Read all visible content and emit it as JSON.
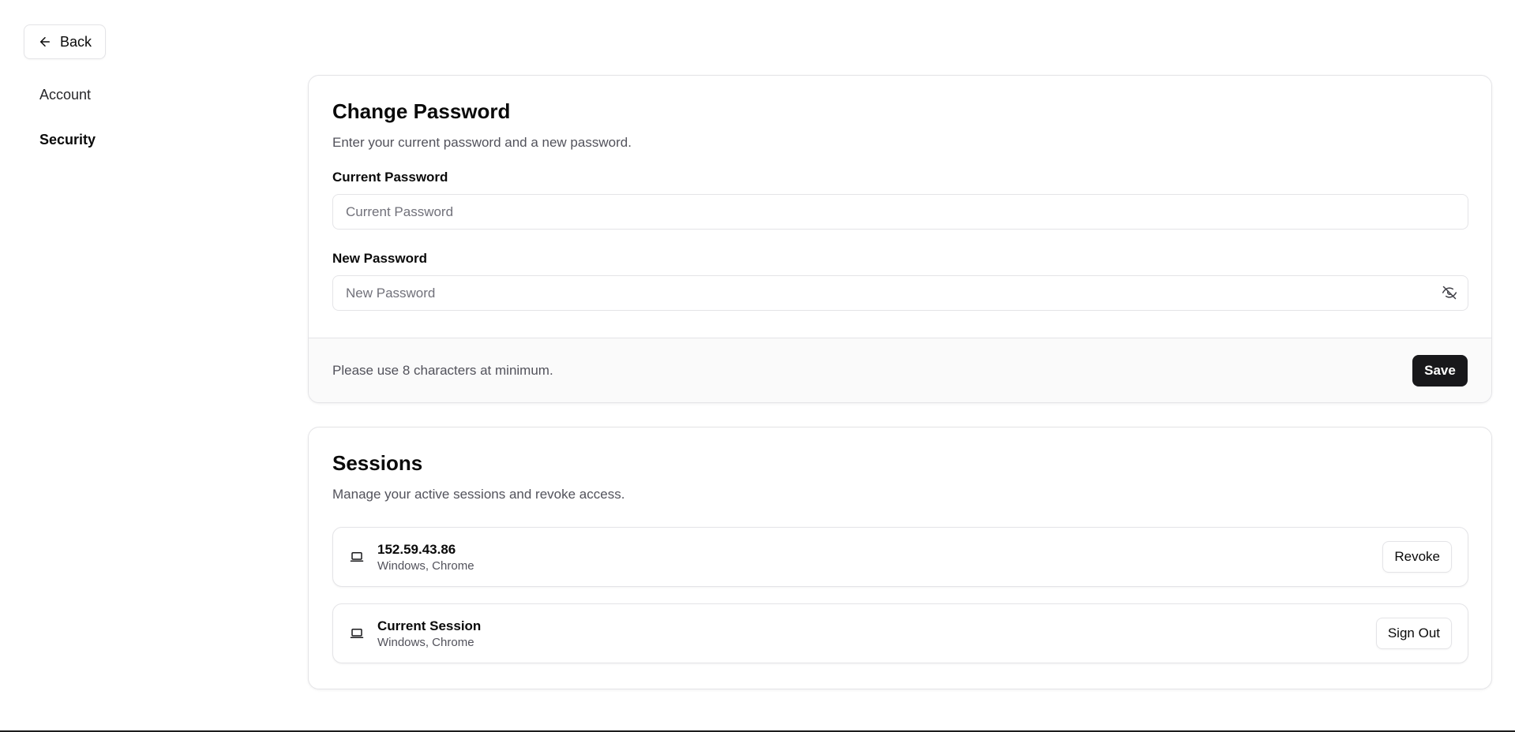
{
  "nav": {
    "back_label": "Back",
    "items": [
      {
        "label": "Account",
        "active": false
      },
      {
        "label": "Security",
        "active": true
      }
    ]
  },
  "change_password": {
    "title": "Change Password",
    "description": "Enter your current password and a new password.",
    "current_password": {
      "label": "Current Password",
      "placeholder": "Current Password",
      "value": ""
    },
    "new_password": {
      "label": "New Password",
      "placeholder": "New Password",
      "value": "",
      "visibility_icon": "eye-off-icon"
    },
    "footer_note": "Please use 8 characters at minimum.",
    "save_label": "Save"
  },
  "sessions": {
    "title": "Sessions",
    "description": "Manage your active sessions and revoke access.",
    "items": [
      {
        "name": "152.59.43.86",
        "meta": "Windows, Chrome",
        "action": "Revoke",
        "icon": "laptop-icon"
      },
      {
        "name": "Current Session",
        "meta": "Windows, Chrome",
        "action": "Sign Out",
        "icon": "laptop-icon"
      }
    ]
  },
  "colors": {
    "primary_button": "#18181b",
    "border": "#e4e4e7",
    "muted_text": "#52525b",
    "footer_bg": "#fafafa"
  }
}
